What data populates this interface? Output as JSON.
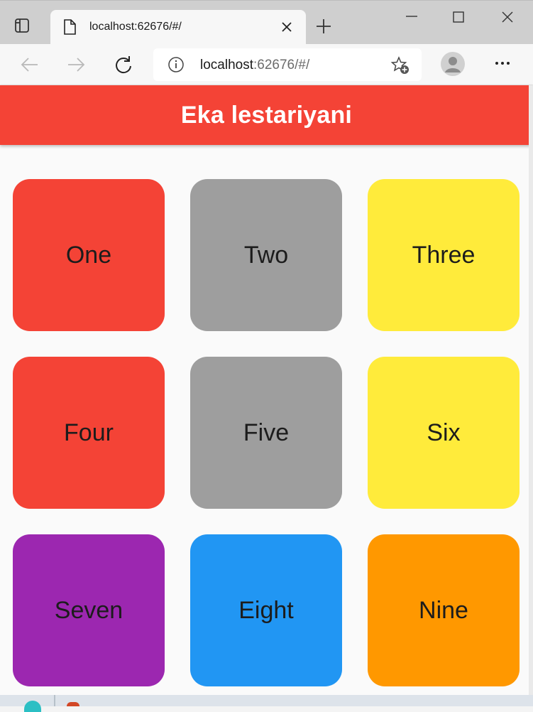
{
  "browser": {
    "tab_title": "localhost:62676/#/",
    "url_host": "localhost",
    "url_rest": ":62676/#/"
  },
  "app": {
    "title": "Eka lestariyani"
  },
  "tiles": [
    {
      "label": "One",
      "color": "#f44336"
    },
    {
      "label": "Two",
      "color": "#9e9e9e"
    },
    {
      "label": "Three",
      "color": "#ffeb3b"
    },
    {
      "label": "Four",
      "color": "#f44336"
    },
    {
      "label": "Five",
      "color": "#9e9e9e"
    },
    {
      "label": "Six",
      "color": "#ffeb3b"
    },
    {
      "label": "Seven",
      "color": "#9c27b0"
    },
    {
      "label": "Eight",
      "color": "#2196f3"
    },
    {
      "label": "Nine",
      "color": "#ff9800"
    }
  ],
  "icons": {
    "tab_actions": "tab-actions-icon",
    "page": "page-icon",
    "close_tab": "close-icon",
    "new_tab": "plus-icon",
    "minimize": "minimize-icon",
    "maximize": "maximize-icon",
    "close_window": "close-icon",
    "back": "arrow-left-icon",
    "forward": "arrow-right-icon",
    "reload": "reload-icon",
    "info": "info-icon",
    "favorites": "star-plus-icon",
    "profile": "avatar-icon",
    "more": "more-icon"
  }
}
